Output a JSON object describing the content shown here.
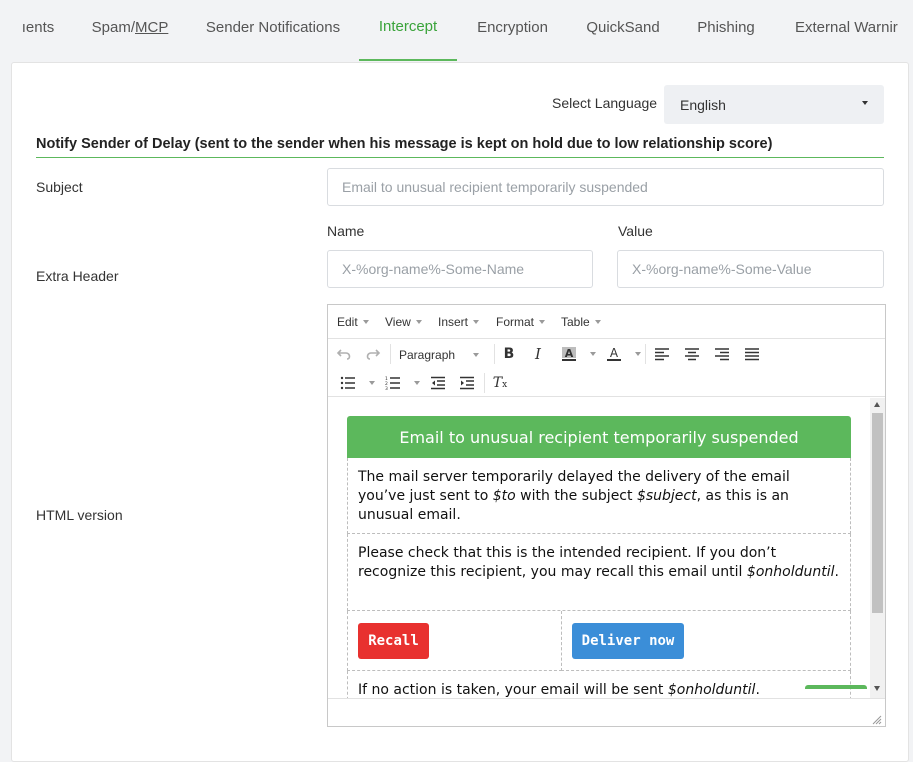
{
  "tabs": [
    {
      "label": "ıents",
      "active": false
    },
    {
      "label": "Spam/",
      "label_underlined": "MCP",
      "active": false
    },
    {
      "label": "Sender Notifications",
      "active": false
    },
    {
      "label": "Intercept",
      "active": true
    },
    {
      "label": "Encryption",
      "active": false
    },
    {
      "label": "QuickSand",
      "active": false
    },
    {
      "label": "Phishing",
      "active": false
    },
    {
      "label": "External Warnir",
      "active": false
    }
  ],
  "language": {
    "label": "Select Language",
    "selected": "English"
  },
  "section": {
    "title": "Notify Sender of Delay (sent to the sender when his message is kept on hold due to low relationship score)"
  },
  "fields": {
    "subject_label": "Subject",
    "subject_placeholder": "Email to unusual recipient temporarily suspended",
    "extra_header_label": "Extra Header",
    "name_label": "Name",
    "name_placeholder": "X-%org-name%-Some-Name",
    "value_label": "Value",
    "value_placeholder": "X-%org-name%-Some-Value",
    "html_version_label": "HTML version"
  },
  "editor": {
    "menu": [
      "Edit",
      "View",
      "Insert",
      "Format",
      "Table"
    ],
    "block_format": "Paragraph",
    "icons": [
      "undo-icon",
      "redo-icon",
      "bold-icon",
      "italic-icon",
      "background-color-icon",
      "text-color-icon",
      "align-left-icon",
      "align-center-icon",
      "align-right-icon",
      "align-justify-icon",
      "bullet-list-icon",
      "numbered-list-icon",
      "outdent-icon",
      "indent-icon",
      "clear-formatting-icon"
    ]
  },
  "email": {
    "header": "Email to unusual recipient temporarily suspended",
    "para1_a": "The mail server temporarily delayed the delivery of the email you’ve just sent to ",
    "para1_var1": "$to",
    "para1_b": " with the subject ",
    "para1_var2": "$subject",
    "para1_c": ", as this is an unusual email.",
    "para2_a": "Please check that this is the intended recipient. If you don’t recognize this recipient, you may recall this email until ",
    "para2_var": "$onholduntil",
    "para2_b": ".",
    "recall_button": "Recall",
    "deliver_button": "Deliver now",
    "para3_a": "If no action is taken, your email will be sent ",
    "para3_var": "$onholduntil",
    "para3_b": "."
  },
  "colors": {
    "accent": "#5cb85c",
    "recall": "#e8312f",
    "deliver": "#3b8ed8"
  }
}
